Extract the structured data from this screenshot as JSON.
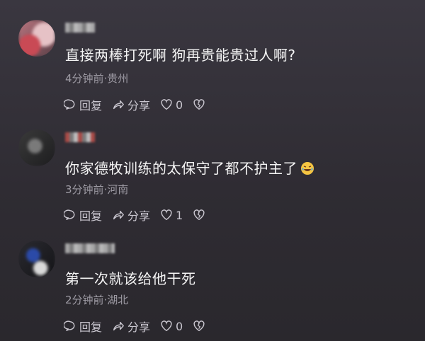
{
  "comments": [
    {
      "text": "直接两棒打死啊  狗再贵能贵过人啊?",
      "meta": "4分钟前·贵州",
      "reply_label": "回复",
      "share_label": "分享",
      "likes": "0"
    },
    {
      "text": "你家德牧训练的太保守了都不护主了",
      "meta": "3分钟前·河南",
      "reply_label": "回复",
      "share_label": "分享",
      "likes": "1"
    },
    {
      "text": "第一次就该给他干死",
      "meta": "2分钟前·湖北",
      "reply_label": "回复",
      "share_label": "分享",
      "likes": "0"
    }
  ],
  "icons": {
    "reply": "reply-icon",
    "share": "share-icon",
    "like": "heart-icon",
    "dislike": "broken-heart-icon",
    "emoji": "laughing-crying-emoji-icon"
  },
  "colors": {
    "background": "#35323a",
    "meta_text": "#9d9aa3",
    "action_text": "#c9c6cf"
  }
}
